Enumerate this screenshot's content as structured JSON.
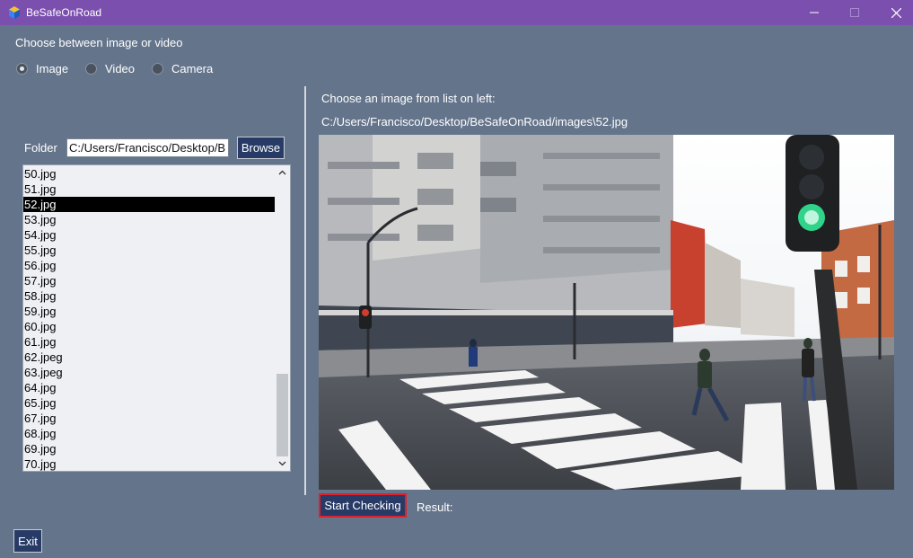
{
  "window": {
    "title": "BeSafeOnRoad"
  },
  "source": {
    "heading": "Choose between image or video",
    "options": [
      {
        "label": "Image",
        "checked": true
      },
      {
        "label": "Video",
        "checked": false
      },
      {
        "label": "Camera",
        "checked": false
      }
    ]
  },
  "left_panel": {
    "folder_label": "Folder",
    "folder_value": "C:/Users/Francisco/Desktop/B",
    "browse_label": "Browse",
    "files": [
      "50.jpg",
      "51.jpg",
      "52.jpg",
      "53.jpg",
      "54.jpg",
      "55.jpg",
      "56.jpg",
      "57.jpg",
      "58.jpg",
      "59.jpg",
      "60.jpg",
      "61.jpg",
      "62.jpeg",
      "63.jpeg",
      "64.jpg",
      "65.jpg",
      "67.jpg",
      "68.jpg",
      "69.jpg",
      "70.jpg"
    ],
    "selected_file": "52.jpg"
  },
  "right_panel": {
    "choose_label": "Choose an image from list on left:",
    "image_path": "C:/Users/Francisco/Desktop/BeSafeOnRoad/images\\52.jpg",
    "start_label": "Start Checking",
    "result_label": "Result:"
  },
  "footer": {
    "exit_label": "Exit"
  },
  "colors": {
    "title_bar": "#7b4fae",
    "background": "#64748b",
    "button": "#283b67",
    "highlight_border": "#e0202a"
  }
}
